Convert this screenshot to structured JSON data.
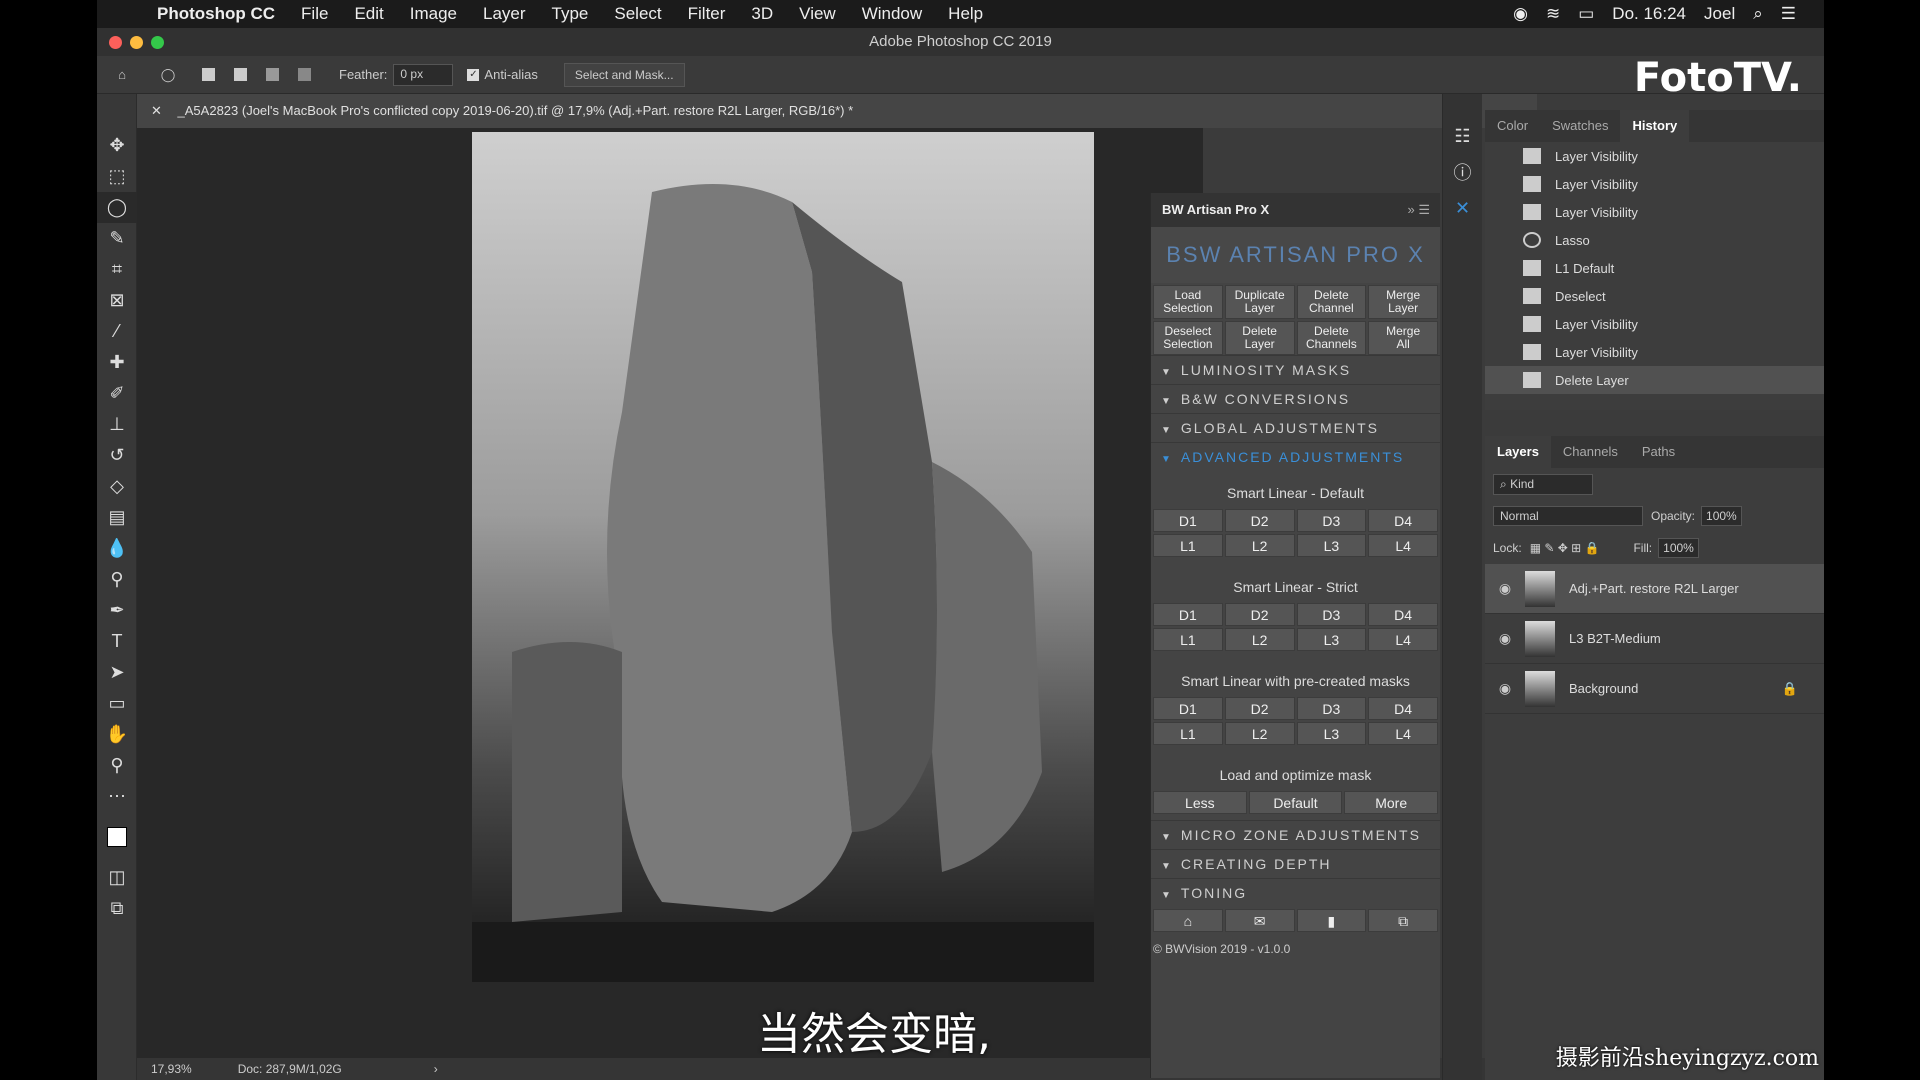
{
  "menubar": {
    "app_name": "Photoshop CC",
    "items": [
      "File",
      "Edit",
      "Image",
      "Layer",
      "Type",
      "Select",
      "Filter",
      "3D",
      "View",
      "Window",
      "Help"
    ],
    "clock": "Do. 16:24",
    "user": "Joel"
  },
  "window": {
    "title": "Adobe Photoshop CC 2019"
  },
  "options": {
    "feather_label": "Feather:",
    "feather_value": "0 px",
    "antialias_label": "Anti-alias",
    "select_mask_label": "Select and Mask..."
  },
  "document": {
    "tab_title": "_A5A2823 (Joel's MacBook Pro's conflicted copy 2019-06-20).tif @ 17,9% (Adj.+Part. restore R2L Larger, RGB/16*) *"
  },
  "status": {
    "zoom": "17,93%",
    "doc": "Doc: 287,9M/1,02G"
  },
  "subtitle": "当然会变暗,",
  "extension": {
    "title": "BW Artisan Pro X",
    "logo_text": "BSW ARTISAN PRO X",
    "top_buttons": [
      {
        "a": "Load",
        "b": "Selection"
      },
      {
        "a": "Duplicate",
        "b": "Layer"
      },
      {
        "a": "Delete",
        "b": "Channel"
      },
      {
        "a": "Merge",
        "b": "Layer"
      },
      {
        "a": "Deselect",
        "b": "Selection"
      },
      {
        "a": "Delete",
        "b": "Layer"
      },
      {
        "a": "Delete",
        "b": "Channels"
      },
      {
        "a": "Merge",
        "b": "All"
      }
    ],
    "sections_top": [
      "LUMINOSITY MASKS",
      "B&W CONVERSIONS",
      "GLOBAL ADJUSTMENTS"
    ],
    "active_section": "ADVANCED ADJUSTMENTS",
    "smart_default": "Smart Linear - Default",
    "smart_strict": "Smart Linear - Strict",
    "smart_masks": "Smart Linear with pre-created masks",
    "d_labels": [
      "D1",
      "D2",
      "D3",
      "D4"
    ],
    "l_labels": [
      "L1",
      "L2",
      "L3",
      "L4"
    ],
    "optimize_title": "Load and optimize mask",
    "optimize_buttons": [
      "Less",
      "Default",
      "More"
    ],
    "sections_bottom": [
      "MICRO ZONE ADJUSTMENTS",
      "CREATING DEPTH",
      "TONING"
    ],
    "copyright": "© BWVision 2019 - v1.0.0"
  },
  "history_panel": {
    "tabs": [
      "Color",
      "Swatches",
      "History"
    ],
    "active_tab": "History",
    "items": [
      "Layer Visibility",
      "Layer Visibility",
      "Layer Visibility",
      "Lasso",
      "L1 Default",
      "Deselect",
      "Layer Visibility",
      "Layer Visibility",
      "Delete Layer"
    ]
  },
  "layers_panel": {
    "tabs": [
      "Layers",
      "Channels",
      "Paths"
    ],
    "kind": "Kind",
    "blend_mode": "Normal",
    "opacity_label": "Opacity:",
    "opacity": "100%",
    "lock_label": "Lock:",
    "fill_label": "Fill:",
    "fill": "100%",
    "layers": [
      "Adj.+Part. restore R2L Larger",
      "L3 B2T-Medium",
      "Background"
    ]
  },
  "watermarks": {
    "brand": "FotoTV.",
    "site": "摄影前沿sheyingzyz.com"
  }
}
